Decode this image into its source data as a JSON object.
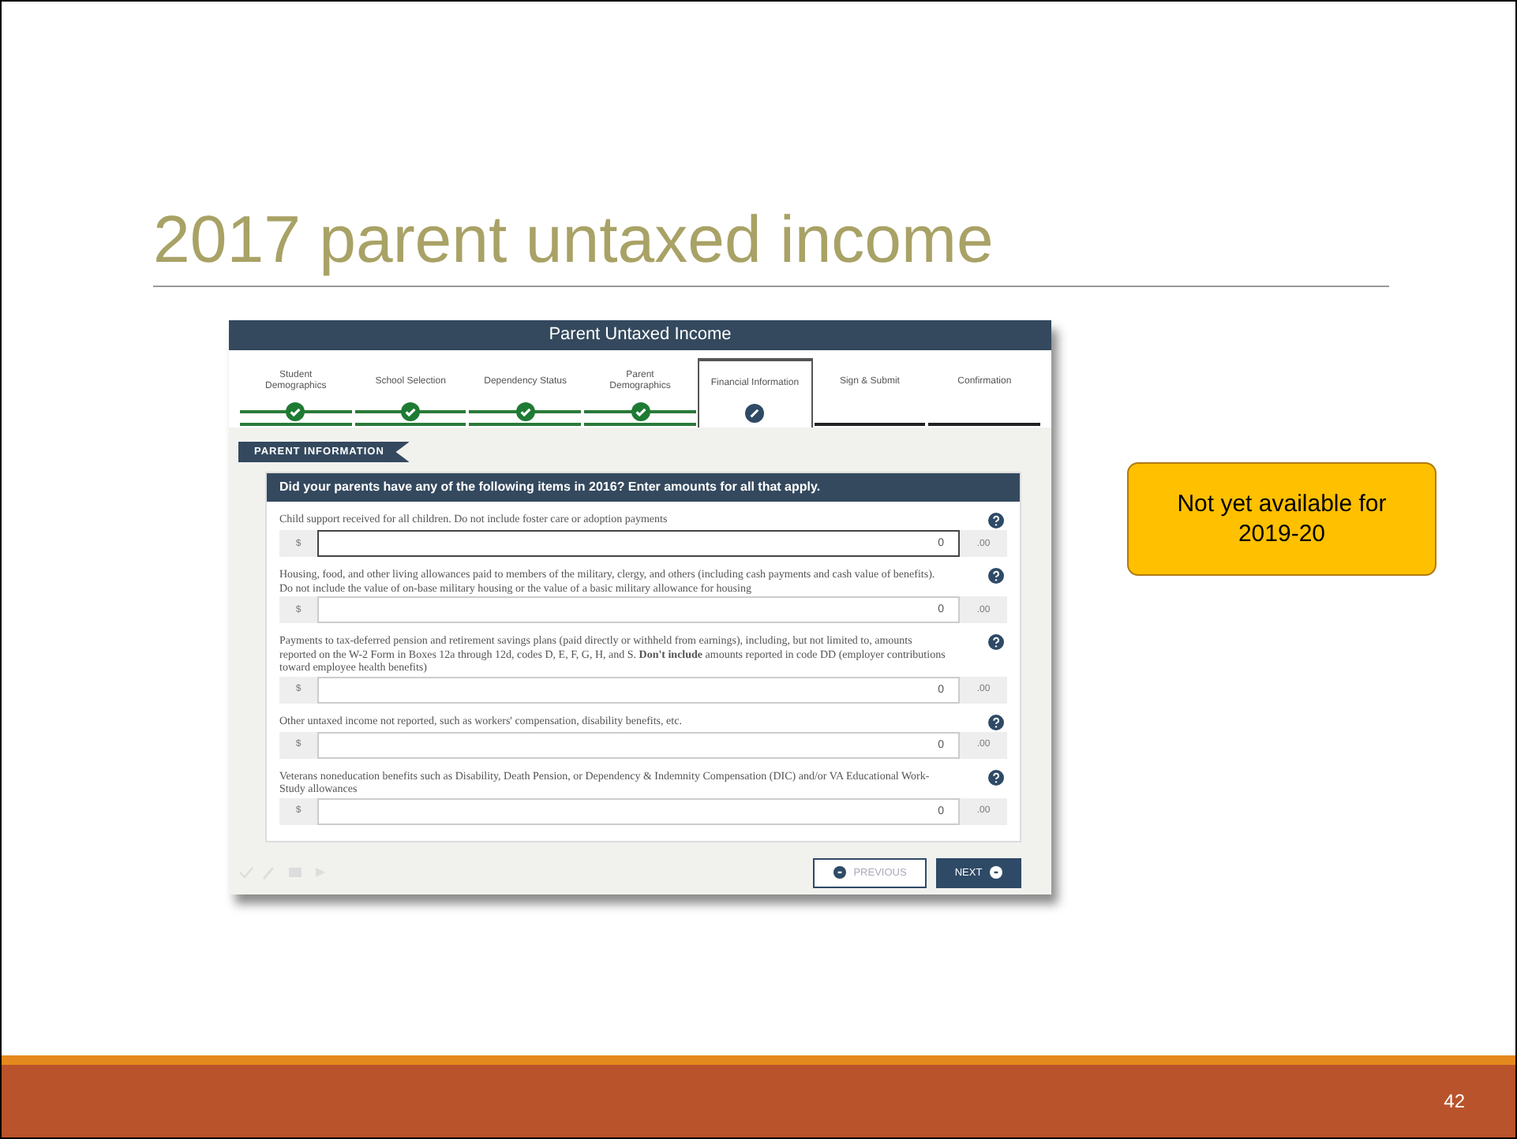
{
  "slide": {
    "title": "2017 parent untaxed income",
    "page_number": "42"
  },
  "callout": {
    "text": "Not yet available for 2019-20"
  },
  "form": {
    "header": "Parent Untaxed Income",
    "steps": [
      {
        "label": "Student Demographics",
        "kind": "done",
        "selected": false
      },
      {
        "label": "School Selection",
        "kind": "done",
        "selected": false
      },
      {
        "label": "Dependency Status",
        "kind": "done",
        "selected": false
      },
      {
        "label": "Parent Demographics",
        "kind": "done",
        "selected": false
      },
      {
        "label": "Financial Information",
        "kind": "current",
        "selected": true
      },
      {
        "label": "Sign & Submit",
        "kind": "todo",
        "selected": false
      },
      {
        "label": "Confirmation",
        "kind": "todo",
        "selected": false
      }
    ],
    "section": "PARENT INFORMATION",
    "question": "Did your parents have any of the following items in 2016? Enter amounts for all that apply.",
    "fields": [
      {
        "label": "Child support received for all children. Do not include foster care or adoption payments",
        "currency": "$",
        "value": "0",
        "cents": ".00",
        "focused": true
      },
      {
        "label": "Housing, food, and other living allowances paid to members of the military, clergy, and others (including cash payments and cash value of benefits). Do not include the value of on-base military housing or the value of a basic military allowance for housing",
        "currency": "$",
        "value": "0",
        "cents": ".00",
        "focused": false
      },
      {
        "label": "Payments to tax-deferred pension and retirement savings plans (paid directly or withheld from earnings), including, but not limited to, amounts reported on the W-2 Form in Boxes 12a through 12d, codes D, E, F, G, H, and S. **Don't include** amounts reported in code DD (employer contributions toward employee health benefits)",
        "currency": "$",
        "value": "0",
        "cents": ".00",
        "focused": false
      },
      {
        "label": "Other untaxed income not reported, such as workers' compensation, disability benefits, etc.",
        "currency": "$",
        "value": "0",
        "cents": ".00",
        "focused": false
      },
      {
        "label": "Veterans noneducation benefits such as Disability, Death Pension, or Dependency & Indemnity Compensation (DIC) and/or VA Educational Work-Study allowances",
        "currency": "$",
        "value": "0",
        "cents": ".00",
        "focused": false
      }
    ],
    "buttons": [
      {
        "label": "PREVIOUS",
        "kind": "secondary"
      },
      {
        "label": "NEXT",
        "kind": "primary"
      }
    ]
  }
}
